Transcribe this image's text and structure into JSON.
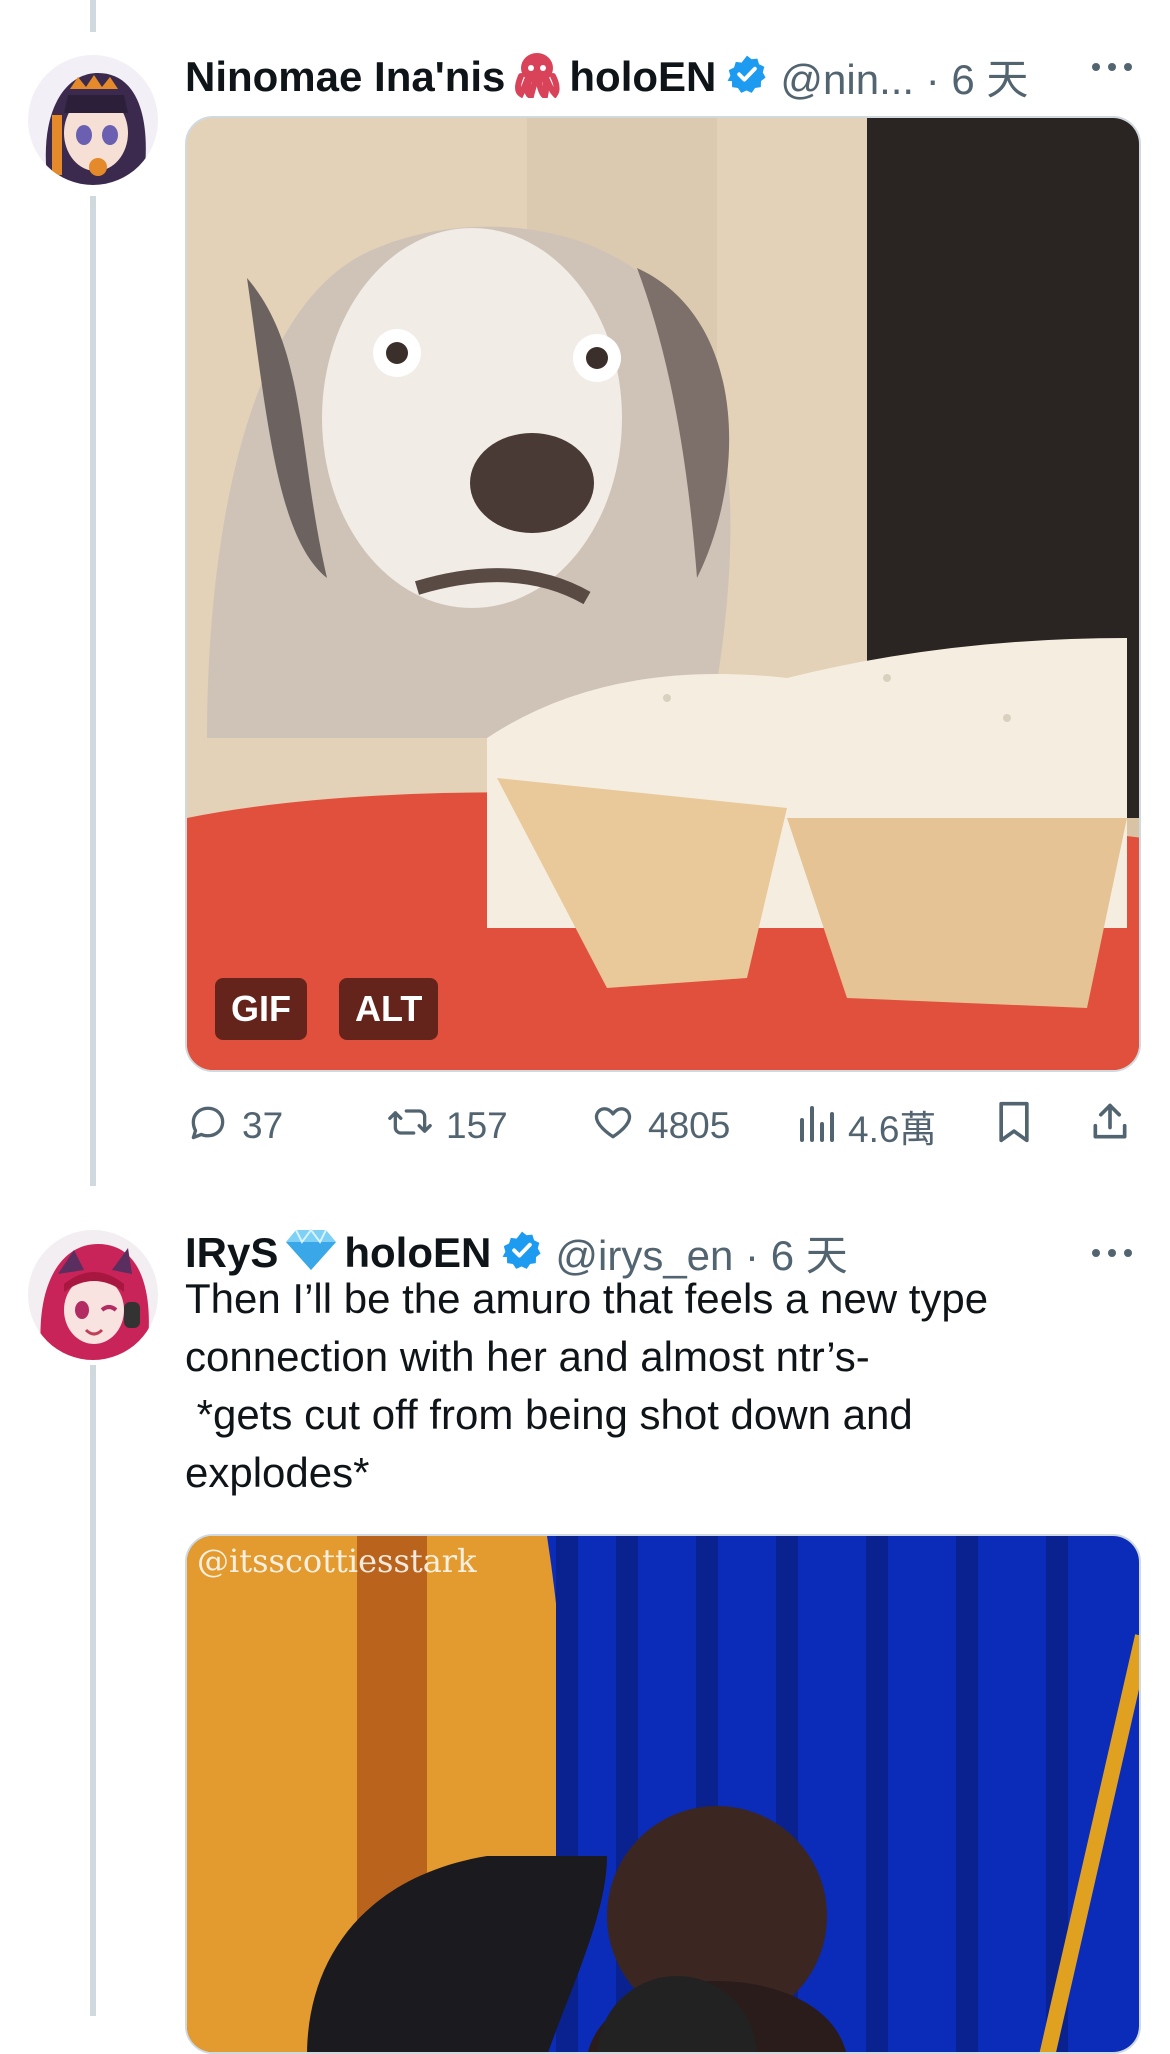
{
  "tweets": [
    {
      "author_name": "Ninomae Ina'nis",
      "author_emoji": "octopus",
      "author_suffix": "holoEN",
      "handle_time": "@nin... · 6 天",
      "media_badges": [
        "GIF",
        "ALT"
      ],
      "stats": {
        "replies": "37",
        "retweets": "157",
        "likes": "4805",
        "views": "4.6萬"
      }
    },
    {
      "author_name": "IRyS",
      "author_emoji": "diamond",
      "author_suffix": "holoEN",
      "handle_time": "@irys_en · 6 天",
      "text_lines": [
        "Then I’ll be the amuro that feels a new type",
        "connection with her and almost ntr’s-",
        " *gets cut off from being shot down and",
        "explodes*"
      ],
      "media_watermark": "@itsscottiesstark"
    }
  ],
  "icons": [
    "reply-icon",
    "retweet-icon",
    "like-icon",
    "views-icon",
    "bookmark-icon",
    "share-icon",
    "more-icon",
    "verified-badge-icon",
    "octopus-icon",
    "diamond-icon"
  ],
  "colors": {
    "verified": "#1d9bf0",
    "secondary_text": "#536471",
    "thread_line": "#cfd9de"
  }
}
